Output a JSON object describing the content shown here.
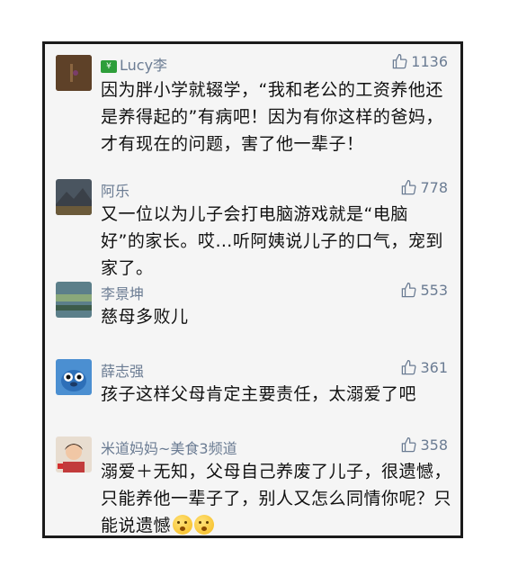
{
  "comments": [
    {
      "name": "Lucy李",
      "likes": "1136",
      "text": "因为胖小学就辍学，“我和老公的工资养他还是养得起的”有病吧！因为有你这样的爸妈，才有现在的问题，害了他一辈子！"
    },
    {
      "name": "阿乐",
      "likes": "778",
      "text": "又一位以为儿子会打电脑游戏就是“电脑好”的家长。哎…听阿姨说儿子的口气，宠到家了。"
    },
    {
      "name": "李景坤",
      "likes": "553",
      "text": "慈母多败儿"
    },
    {
      "name": "薛志强",
      "likes": "361",
      "text": "孩子这样父母肯定主要责任，太溺爱了吧"
    },
    {
      "name": "米道妈妈~美食3频道",
      "likes": "358",
      "text": "溺爱＋无知，父母自己养废了儿子，很遗憾，只能养他一辈子了，别人又怎么同情你呢？只能说遗憾"
    }
  ],
  "colors": {
    "name": "#6b7c93",
    "text": "#111111",
    "background": "#f5f5f5",
    "border": "#1a1a1a"
  },
  "icons": {
    "like": "thumbs-up-outline-icon",
    "emoji": "thinking-face-emoji"
  }
}
